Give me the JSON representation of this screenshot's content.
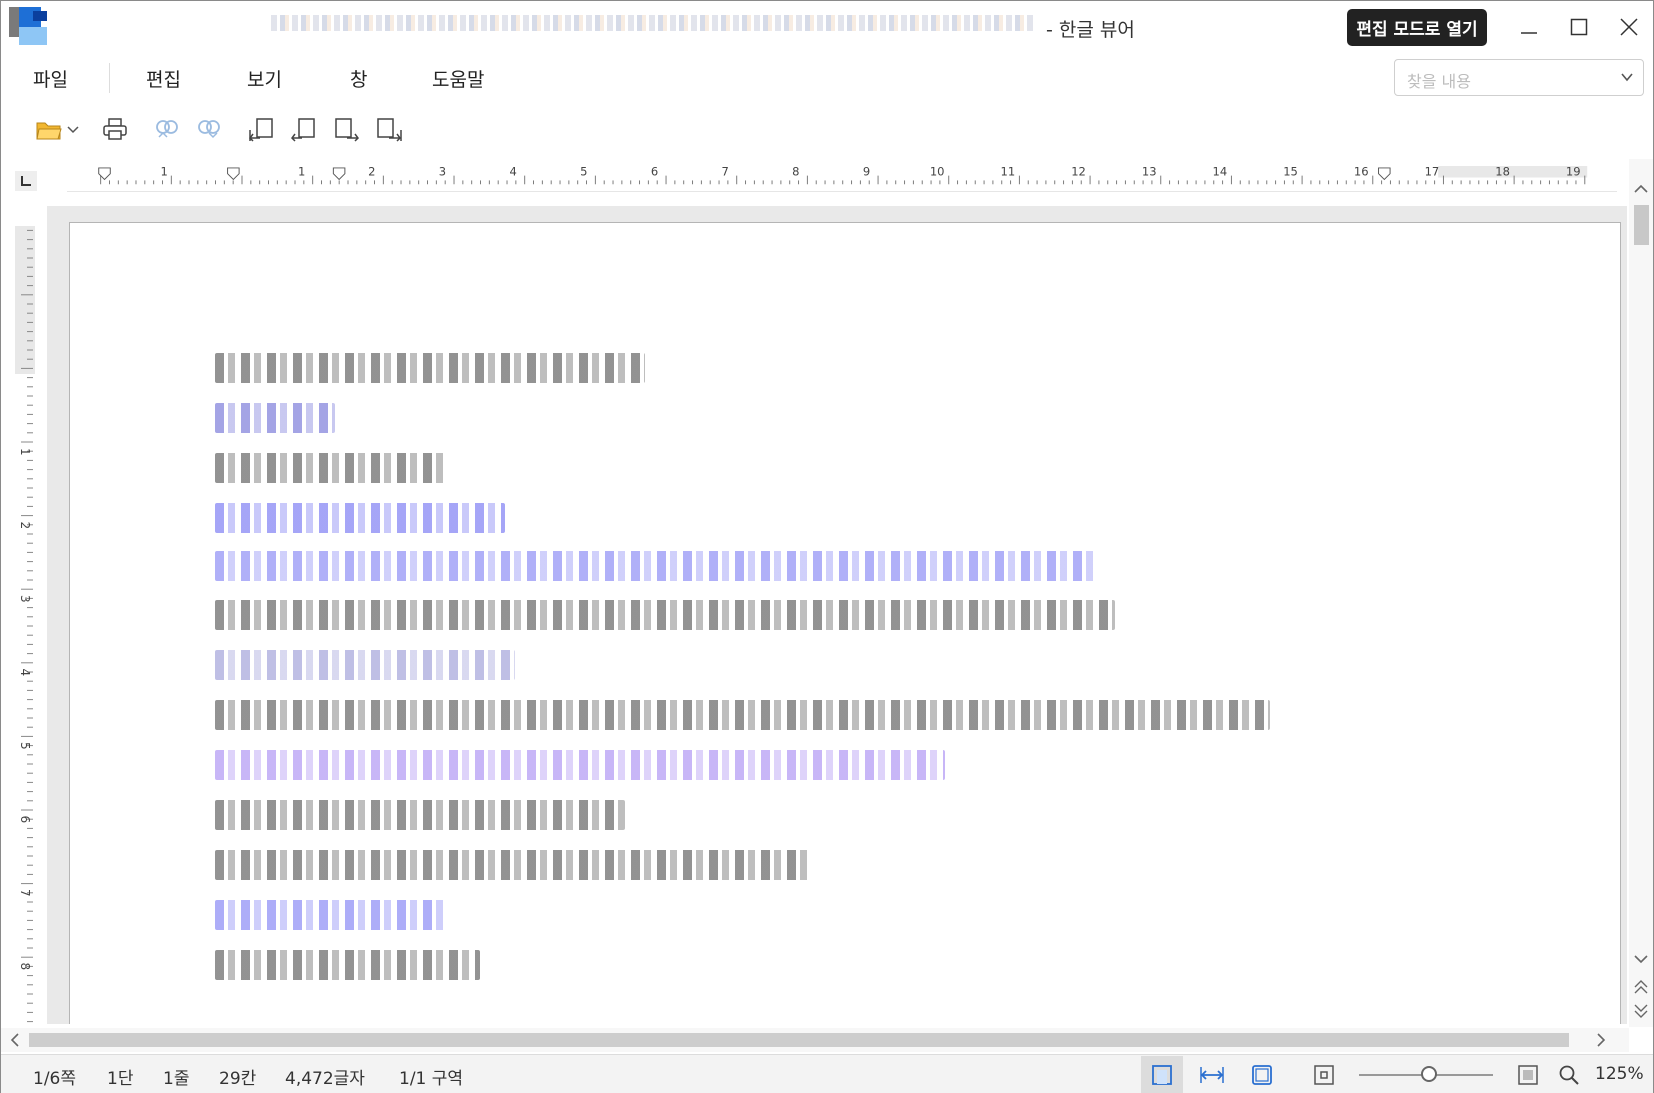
{
  "title_bar": {
    "title": "- 한글 뷰어",
    "edit_mode_button": "편집 모드로 열기"
  },
  "menu": {
    "items": [
      "파일",
      "편집",
      "보기",
      "창",
      "도움말"
    ]
  },
  "search": {
    "placeholder": "찾을 내용"
  },
  "toolbar": {
    "icons": [
      "open-folder-icon",
      "dropdown-arrow-icon",
      "print-icon",
      "link-icon",
      "unlink-icon",
      "indent-left-icon",
      "outdent-left-icon",
      "indent-right-icon",
      "outdent-right-icon"
    ]
  },
  "ruler": {
    "horizontal_ticks": [
      "1",
      "1",
      "2",
      "3",
      "4",
      "5",
      "6",
      "7",
      "8",
      "9",
      "10",
      "11",
      "12",
      "13",
      "14",
      "15",
      "16",
      "17",
      "18",
      "19"
    ],
    "vertical_ticks": [
      "1",
      "2",
      "3",
      "4",
      "5",
      "6",
      "7",
      "8"
    ]
  },
  "document": {
    "line_colors": [
      "#3a3a3a",
      "#5a5ad0",
      "#3a3a3a",
      "#5c5cf0",
      "#6f6ff2",
      "#3a3a3a",
      "#8b8bd0",
      "#3a3a3a",
      "#9a7af0",
      "#3a3a3a",
      "#3a3a3a",
      "#6a6af2"
    ]
  },
  "status": {
    "page": "1/6쪽",
    "column": "1단",
    "line": "1줄",
    "cell": "29칸",
    "chars": "4,472글자",
    "section": "1/1 구역",
    "zoom": "125%"
  }
}
